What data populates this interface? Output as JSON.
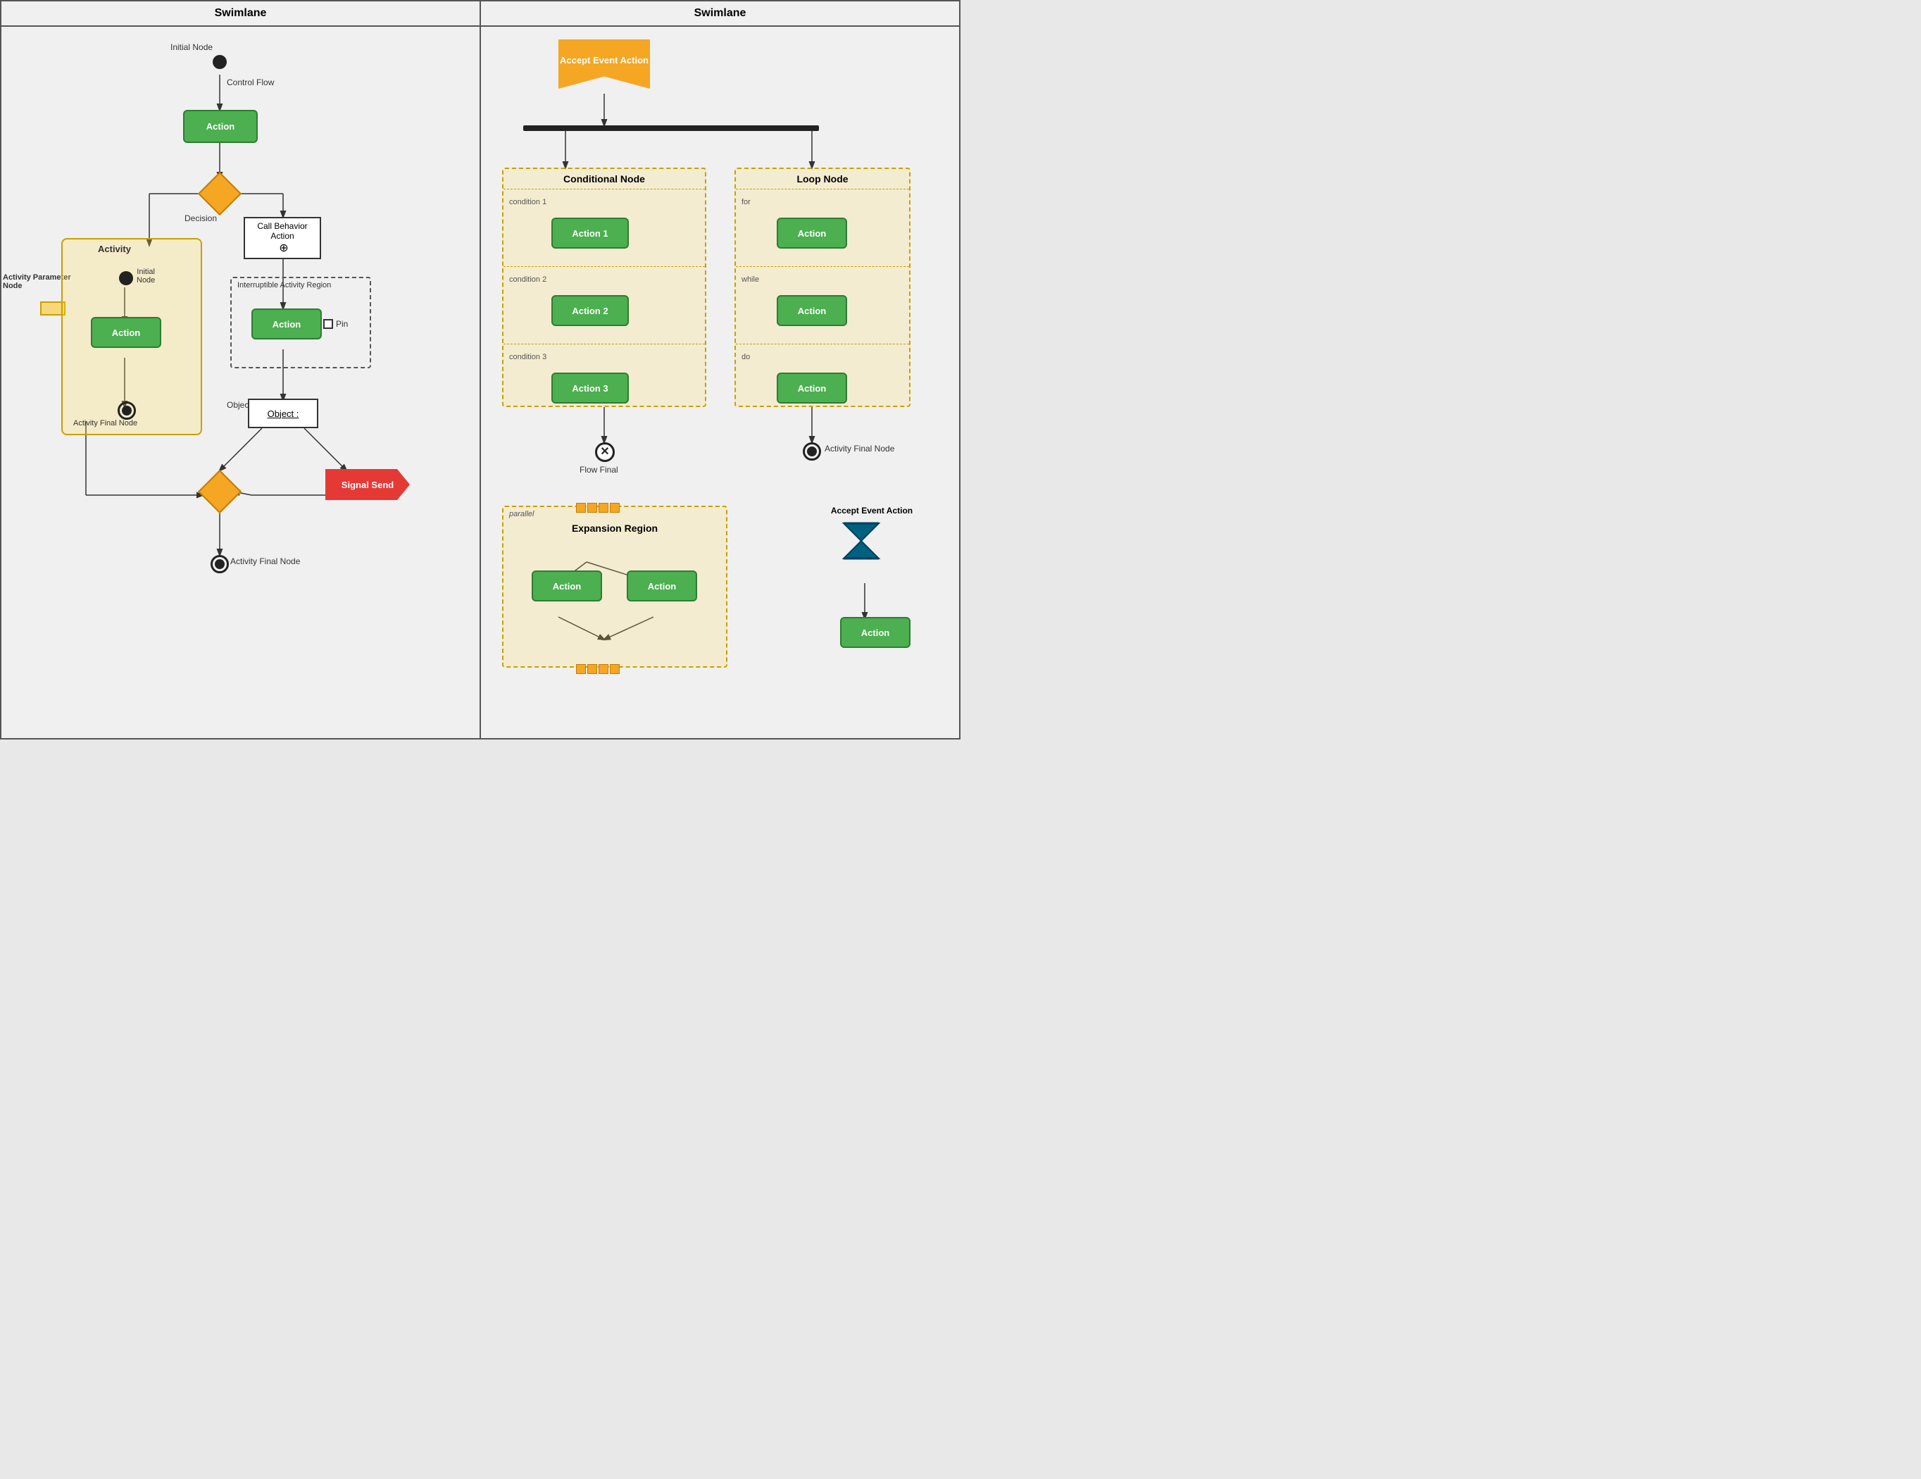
{
  "swimlane1": {
    "header": "Swimlane",
    "nodes": {
      "initialNode": {
        "label": "Initial Node"
      },
      "controlFlow": {
        "label": "Control Flow"
      },
      "action1": {
        "label": "Action"
      },
      "decision": {
        "label": "Decision"
      },
      "activityParamNode": {
        "label": "Activity Parameter\nNode"
      },
      "activity": {
        "label": "Activity"
      },
      "activityInitialNode": {
        "label": "Initial\nNode"
      },
      "activityAction": {
        "label": "Action"
      },
      "activityFinalNode1": {
        "label": "Activity Final Node"
      },
      "callBehaviorAction": {
        "label": "Call Behavior\nAction"
      },
      "interruptibleRegion": {
        "label": "Interruptible Activity Region"
      },
      "regionAction": {
        "label": "Action"
      },
      "pin": {
        "label": "Pin"
      },
      "objectFlow": {
        "label": "Object\nFlow"
      },
      "objectNode": {
        "label": "Object :"
      },
      "signalSend": {
        "label": "Signal Send"
      },
      "diamond2": {},
      "activityFinalNode2": {
        "label": "Activity\nFinal\nNode"
      }
    }
  },
  "swimlane2": {
    "header": "Swimlane",
    "nodes": {
      "acceptEventAction": {
        "label": "Accept Event\nAction"
      },
      "forkBar": {},
      "conditionalNode": {
        "label": "Conditional Node",
        "conditions": [
          "condition 1",
          "condition 2",
          "condition 3"
        ],
        "actions": [
          "Action 1",
          "Action 2",
          "Action 3"
        ]
      },
      "loopNode": {
        "label": "Loop Node",
        "conditions": [
          "for",
          "while",
          "do"
        ],
        "actions": [
          "Action",
          "Action",
          "Action"
        ]
      },
      "flowFinal": {
        "label": "Flow\nFinal"
      },
      "activityFinalNode": {
        "label": "Activity\nFinal\nNode"
      },
      "expansionRegion": {
        "label": "Expansion Region",
        "italic": "parallel",
        "actions": [
          "Action",
          "Action"
        ]
      },
      "acceptEventAction2": {
        "label": "Accept Event Action"
      },
      "action2": {
        "label": "Action"
      }
    }
  }
}
